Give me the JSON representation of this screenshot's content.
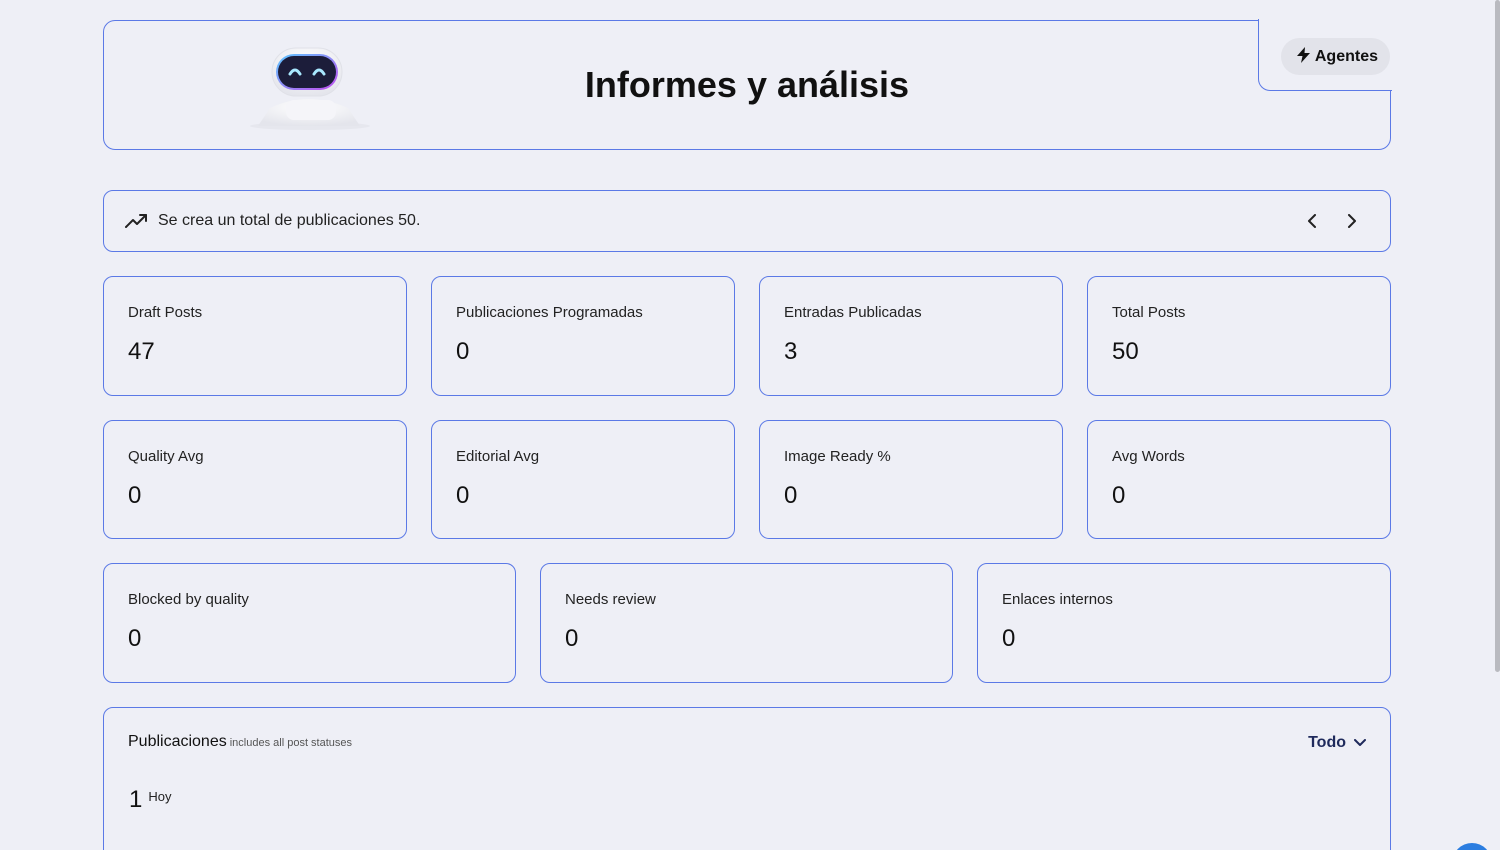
{
  "header": {
    "title": "Informes y análisis",
    "agents_label": "Agentes"
  },
  "banner": {
    "text": "Se crea un total de publicaciones 50."
  },
  "stats_row1": [
    {
      "label": "Draft Posts",
      "value": "47"
    },
    {
      "label": "Publicaciones Programadas",
      "value": "0"
    },
    {
      "label": "Entradas Publicadas",
      "value": "3"
    },
    {
      "label": "Total Posts",
      "value": "50"
    }
  ],
  "stats_row2": [
    {
      "label": "Quality Avg",
      "value": "0"
    },
    {
      "label": "Editorial Avg",
      "value": "0"
    },
    {
      "label": "Image Ready %",
      "value": "0"
    },
    {
      "label": "Avg Words",
      "value": "0"
    }
  ],
  "stats_row3": [
    {
      "label": "Blocked by quality",
      "value": "0"
    },
    {
      "label": "Needs review",
      "value": "0"
    },
    {
      "label": "Enlaces internos",
      "value": "0"
    }
  ],
  "posts": {
    "title": "Publicaciones",
    "subtitle": "includes all post statuses",
    "filter_label": "Todo",
    "count": "1",
    "count_label": "Hoy"
  },
  "colors": {
    "background": "#eeeff6",
    "border": "#5b79e6",
    "filter_text": "#1f2a5c"
  },
  "icons": {
    "banner": "trending-up-icon",
    "agents": "bolt-icon",
    "prev": "chevron-left-icon",
    "next": "chevron-right-icon",
    "filter": "chevron-down-icon"
  }
}
